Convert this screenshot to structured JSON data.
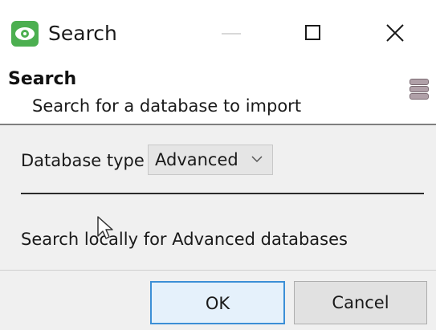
{
  "window": {
    "title": "Search",
    "minimize_icon": "minimize-icon",
    "maximize_icon": "maximize-icon",
    "close_icon": "close-icon"
  },
  "header": {
    "title": "Search",
    "subtitle": "Search for a database to import",
    "icon": "database-icon"
  },
  "form": {
    "database_type_label": "Database type",
    "database_type_value": "Advanced",
    "search_locally_text": "Search locally for Advanced databases"
  },
  "buttons": {
    "ok_label": "OK",
    "cancel_label": "Cancel"
  },
  "colors": {
    "app_icon": "#4caf50",
    "ok_border": "#3c8fd6",
    "ok_background": "#e5f1fb"
  }
}
